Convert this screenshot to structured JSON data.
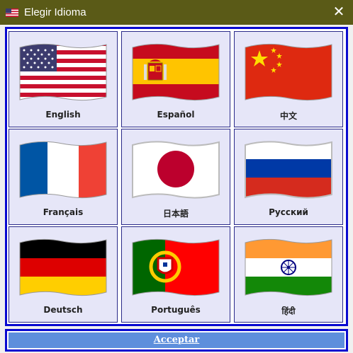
{
  "window": {
    "title": "Elegir Idioma",
    "title_icon": "us-flag-icon",
    "close_glyph": "✕"
  },
  "languages": [
    {
      "label": "English",
      "flag": "us-flag-icon"
    },
    {
      "label": "Español",
      "flag": "spain-flag-icon"
    },
    {
      "label": "中文",
      "flag": "china-flag-icon"
    },
    {
      "label": "Français",
      "flag": "france-flag-icon"
    },
    {
      "label": "日本語",
      "flag": "japan-flag-icon"
    },
    {
      "label": "Русский",
      "flag": "russia-flag-icon"
    },
    {
      "label": "Deutsch",
      "flag": "germany-flag-icon"
    },
    {
      "label": "Português",
      "flag": "portugal-flag-icon"
    },
    {
      "label": "हिंदी",
      "flag": "india-flag-icon"
    }
  ],
  "footer": {
    "accept_label": "Acceptar"
  },
  "colors": {
    "titlebar": "#5a5a17",
    "border_accent": "#0a0ad0",
    "button": "#5e8fdc",
    "tile": "#e6e6f8"
  }
}
